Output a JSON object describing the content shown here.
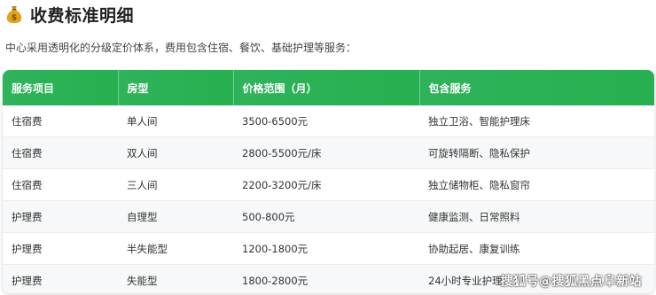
{
  "header": {
    "icon": "money-bag-icon",
    "title": "收费标准明细"
  },
  "intro": "中心采用透明化的分级定价体系，费用包含住宿、餐饮、基础护理等服务：",
  "table": {
    "headers": [
      "服务项目",
      "房型",
      "价格范围（月）",
      "包含服务"
    ],
    "rows": [
      [
        "住宿费",
        "单人间",
        "3500-6500元",
        "独立卫浴、智能护理床"
      ],
      [
        "住宿费",
        "双人间",
        "2800-5500元/床",
        "可旋转隔断、隐私保护"
      ],
      [
        "住宿费",
        "三人间",
        "2200-3200元/床",
        "独立储物柜、隐私窗帘"
      ],
      [
        "护理费",
        "自理型",
        "500-800元",
        "健康监测、日常照料"
      ],
      [
        "护理费",
        "半失能型",
        "1200-1800元",
        "协助起居、康复训练"
      ],
      [
        "护理费",
        "失能型",
        "1800-2800元",
        "24小时专业护理"
      ]
    ]
  },
  "watermark": "搜狐号@搜狐黑点阜新站",
  "colors": {
    "header_green": "#2fb35a",
    "bag_gold": "#e3a21a"
  }
}
